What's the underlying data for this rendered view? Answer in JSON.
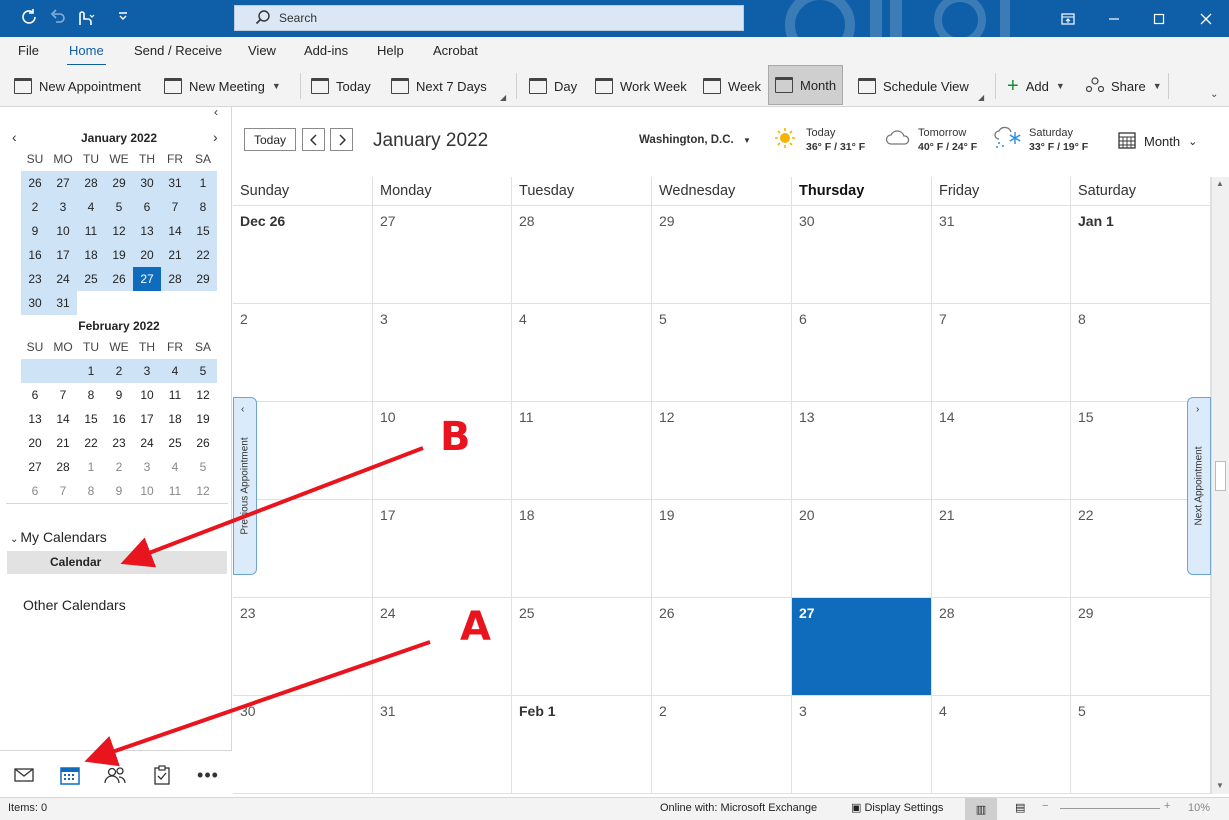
{
  "app": {
    "search_placeholder": "Search",
    "title_icons": [
      "refresh-icon",
      "undo-icon",
      "touch-mode-icon",
      "customize-icon"
    ]
  },
  "menu": [
    "File",
    "Home",
    "Send / Receive",
    "View",
    "Add-ins",
    "Help",
    "Acrobat"
  ],
  "ribbon": {
    "new_appointment": "New Appointment",
    "new_meeting": "New Meeting",
    "today": "Today",
    "next7": "Next 7 Days",
    "day": "Day",
    "work_week": "Work Week",
    "week": "Week",
    "month": "Month",
    "schedule_view": "Schedule View",
    "add": "Add",
    "share": "Share"
  },
  "mini_jan": {
    "title": "January 2022",
    "days": [
      "SU",
      "MO",
      "TU",
      "WE",
      "TH",
      "FR",
      "SA"
    ],
    "cells": [
      "26",
      "27",
      "28",
      "29",
      "30",
      "31",
      "1",
      "2",
      "3",
      "4",
      "5",
      "6",
      "7",
      "8",
      "9",
      "10",
      "11",
      "12",
      "13",
      "14",
      "15",
      "16",
      "17",
      "18",
      "19",
      "20",
      "21",
      "22",
      "23",
      "24",
      "25",
      "26",
      "27",
      "28",
      "29",
      "30",
      "31"
    ]
  },
  "mini_feb": {
    "title": "February 2022",
    "days": [
      "SU",
      "MO",
      "TU",
      "WE",
      "TH",
      "FR",
      "SA"
    ],
    "cells": [
      "",
      "",
      "1",
      "2",
      "3",
      "4",
      "5",
      "6",
      "7",
      "8",
      "9",
      "10",
      "11",
      "12",
      "13",
      "14",
      "15",
      "16",
      "17",
      "18",
      "19",
      "20",
      "21",
      "22",
      "23",
      "24",
      "25",
      "26",
      "27",
      "28",
      "1",
      "2",
      "3",
      "4",
      "5",
      "6",
      "7",
      "8",
      "9",
      "10",
      "11",
      "12"
    ]
  },
  "folders": {
    "my_calendars": "My Calendars",
    "calendar": "Calendar",
    "other_calendars": "Other Calendars"
  },
  "calhead": {
    "today_btn": "Today",
    "month_title": "January 2022",
    "location": "Washington,  D.C.",
    "weather": [
      {
        "label": "Today",
        "temp": "36° F / 31° F"
      },
      {
        "label": "Tomorrow",
        "temp": "40° F / 24° F"
      },
      {
        "label": "Saturday",
        "temp": "33° F / 19° F"
      }
    ],
    "view": "Month"
  },
  "weekdays": [
    "Sunday",
    "Monday",
    "Tuesday",
    "Wednesday",
    "Thursday",
    "Friday",
    "Saturday"
  ],
  "weeks": [
    [
      "Dec 26",
      "27",
      "28",
      "29",
      "30",
      "31",
      "Jan 1"
    ],
    [
      "2",
      "3",
      "4",
      "5",
      "6",
      "7",
      "8"
    ],
    [
      "",
      "10",
      "11",
      "12",
      "13",
      "14",
      "15"
    ],
    [
      "",
      "17",
      "18",
      "19",
      "20",
      "21",
      "22"
    ],
    [
      "23",
      "24",
      "25",
      "26",
      "27",
      "28",
      "29"
    ],
    [
      "30",
      "31",
      "Feb 1",
      "2",
      "3",
      "4",
      "5"
    ]
  ],
  "tabs": {
    "previous": "Previous Appointment",
    "next": "Next Appointment"
  },
  "status": {
    "items": "Items: 0",
    "online": "Online with: Microsoft Exchange",
    "display": "Display Settings",
    "zoom": "10%"
  },
  "annotations": {
    "a": "A",
    "b": "B"
  },
  "colors": {
    "accent": "#0f6cbd",
    "title_bar": "#0f5fa8",
    "annotation": "#e8141e"
  }
}
